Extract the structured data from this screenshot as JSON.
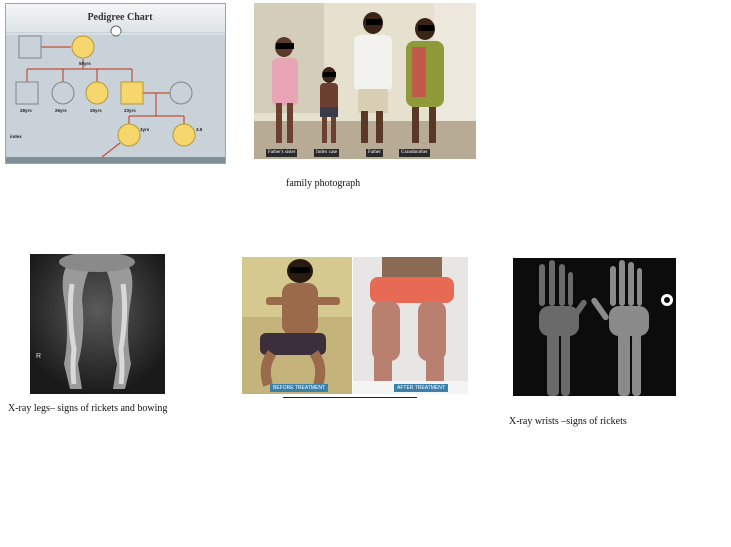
{
  "pedigree": {
    "title": "Pedigree Chart",
    "labels": {
      "gm_age": "55yrs",
      "c1_age": "28yrs",
      "c2_age": "26yrs",
      "c3_age": "25yrs",
      "c4_age": "23yrs",
      "g1_age": "3yrs",
      "g2_age": "3.5",
      "proband": "index"
    }
  },
  "family": {
    "caption": "family photograph",
    "tags": [
      "Father's sister",
      "Index case",
      "Father",
      "Grandmother"
    ]
  },
  "legs": {
    "caption": "X-ray legs– signs of rickets and bowing",
    "marker": "R"
  },
  "child": {
    "before_label": "BEFORE TREATMENT",
    "after_label": "AFTER TREATMENT"
  },
  "wrists": {
    "caption": "X-ray wrists –signs of rickets"
  },
  "colors": {
    "affected": "#f5d76e",
    "line": "#c0503a",
    "unaffected": "#c9d2d8"
  }
}
